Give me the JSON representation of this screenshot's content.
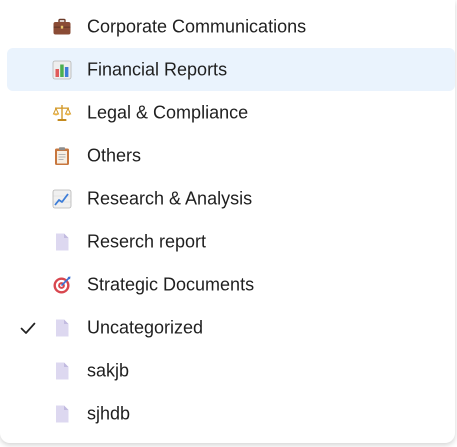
{
  "menu": {
    "items": [
      {
        "label": "Corporate Communications",
        "icon": "briefcase-icon"
      },
      {
        "label": "Financial Reports",
        "icon": "bar-chart-icon",
        "highlighted": true
      },
      {
        "label": "Legal & Compliance",
        "icon": "scales-icon"
      },
      {
        "label": "Others",
        "icon": "clipboard-icon"
      },
      {
        "label": "Research & Analysis",
        "icon": "line-chart-icon"
      },
      {
        "label": "Reserch report",
        "icon": "document-icon"
      },
      {
        "label": "Strategic Documents",
        "icon": "target-icon"
      },
      {
        "label": "Uncategorized",
        "icon": "document-icon",
        "checked": true
      },
      {
        "label": "sakjb",
        "icon": "document-icon"
      },
      {
        "label": "sjhdb",
        "icon": "document-icon"
      }
    ]
  },
  "colors": {
    "highlight_bg": "#eaf3fd",
    "text": "#1f1f1f",
    "document_icon": "#d9d4ee"
  }
}
